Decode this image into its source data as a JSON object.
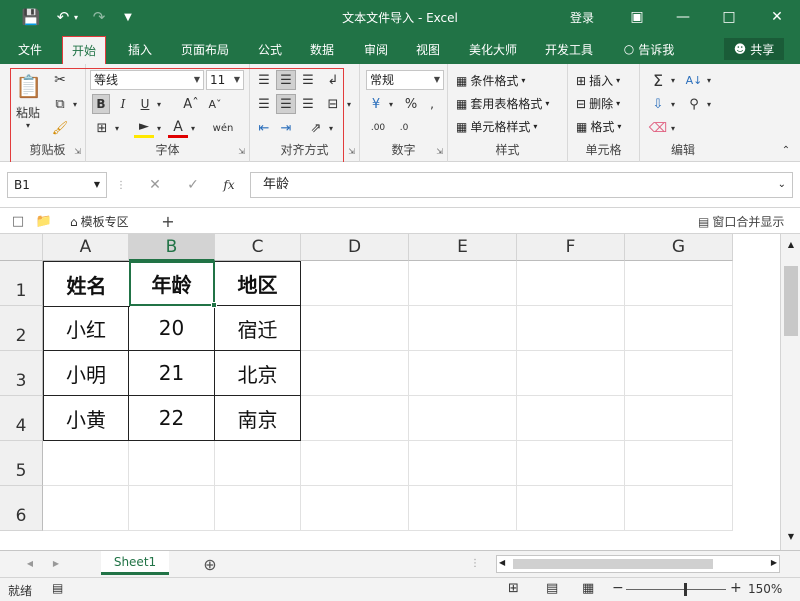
{
  "app": {
    "title": "文本文件导入 - Excel",
    "login_label": "登录"
  },
  "menu": {
    "tabs": [
      "文件",
      "开始",
      "插入",
      "页面布局",
      "公式",
      "数据",
      "审阅",
      "视图",
      "美化大师",
      "开发工具"
    ],
    "tell_me": "告诉我",
    "share": "共享"
  },
  "ribbon": {
    "clipboard": {
      "paste": "粘贴",
      "label": "剪贴板"
    },
    "font": {
      "name": "等线",
      "size": "11",
      "bold": "B",
      "italic": "I",
      "underline": "U",
      "label": "字体"
    },
    "alignment": {
      "label": "对齐方式"
    },
    "number": {
      "format": "常规",
      "percent": "%",
      "label": "数字"
    },
    "styles": {
      "conditional": "条件格式",
      "table": "套用表格格式",
      "cell": "单元格样式",
      "label": "样式"
    },
    "cells": {
      "insert": "插入",
      "delete": "删除",
      "format": "格式",
      "label": "单元格"
    },
    "editing": {
      "label": "编辑"
    }
  },
  "formula_bar": {
    "name_box": "B1",
    "fx": "fx",
    "content": "年龄"
  },
  "tabstrip": {
    "template": "模板专区",
    "merge_window": "窗口合并显示"
  },
  "grid": {
    "columns": [
      "A",
      "B",
      "C",
      "D",
      "E",
      "F",
      "G"
    ],
    "rows": [
      "1",
      "2",
      "3",
      "4",
      "5",
      "6"
    ],
    "cells": [
      [
        "姓名",
        "年龄",
        "地区"
      ],
      [
        "小红",
        "20",
        "宿迁"
      ],
      [
        "小明",
        "21",
        "北京"
      ],
      [
        "小黄",
        "22",
        "南京"
      ]
    ]
  },
  "sheets": {
    "tabs": [
      "Sheet1"
    ]
  },
  "status": {
    "ready": "就绪",
    "zoom": "150%"
  },
  "colors": {
    "accent": "#217346",
    "highlight": "#e23b3b"
  }
}
